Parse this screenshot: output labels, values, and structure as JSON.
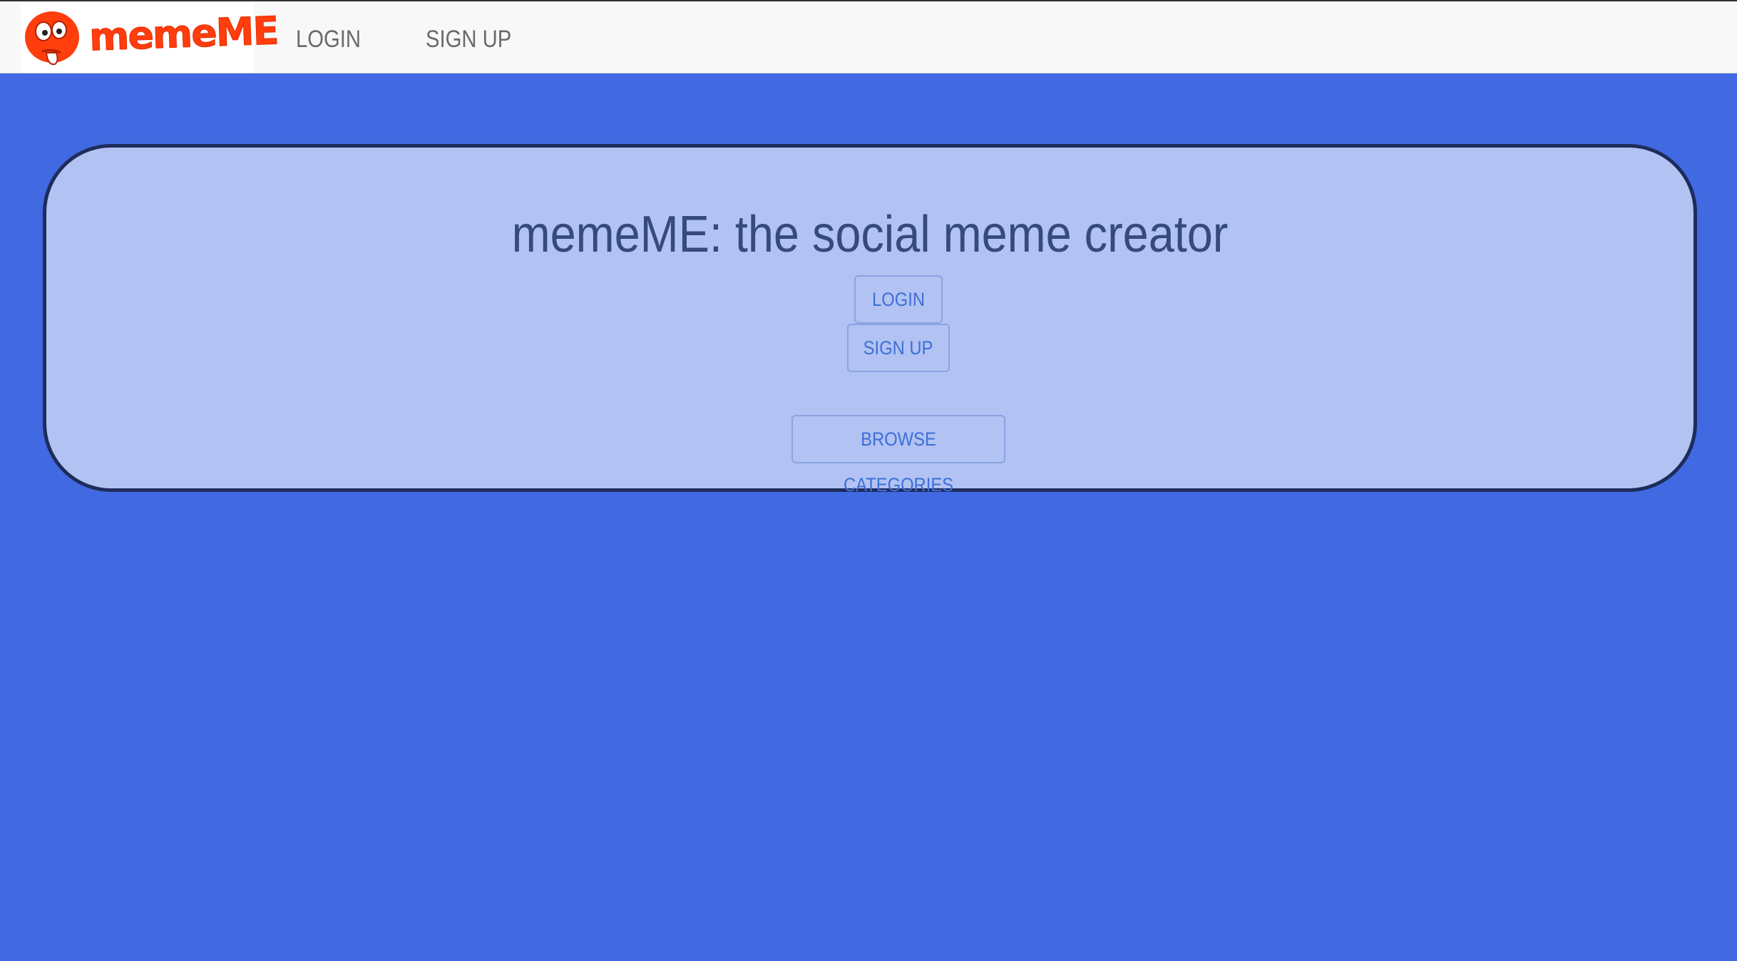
{
  "brand": {
    "logo_text": "memeME",
    "logo_color": "#ff3d0d"
  },
  "navbar": {
    "login_label": "LOGIN",
    "signup_label": "SIGN UP"
  },
  "hero": {
    "title": "memeME: the social meme creator",
    "login_button": "LOGIN",
    "signup_button": "SIGN UP",
    "browse_button": "BROWSE CATEGORIES"
  },
  "colors": {
    "page_background": "#4169e1",
    "hero_background": "#b1c2f3",
    "hero_border": "#1e2c5c",
    "button_text": "#3d6fd6"
  }
}
